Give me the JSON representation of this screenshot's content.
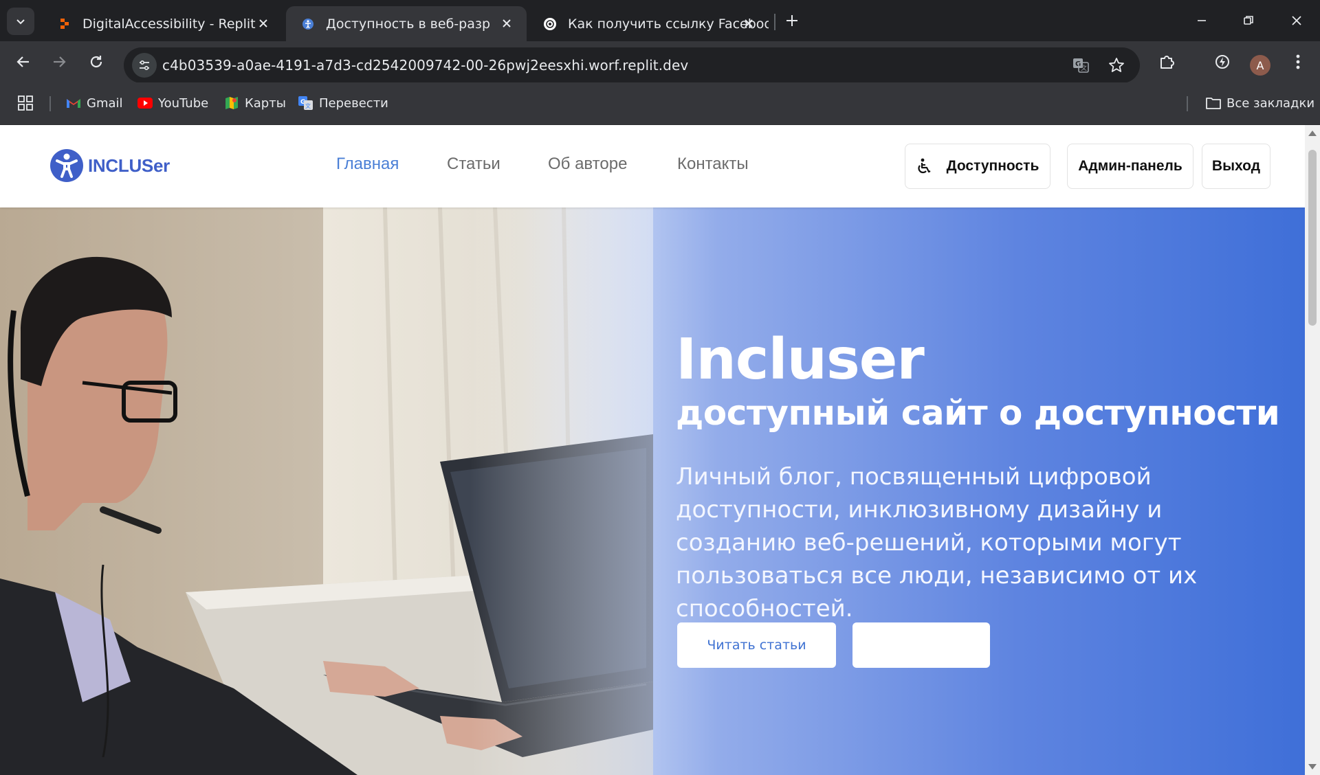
{
  "browser": {
    "tabs": [
      {
        "title": "DigitalAccessibility - Replit",
        "favicon": "replit-icon"
      },
      {
        "title": "Доступность в веб-разработке",
        "favicon": "site-icon",
        "active": true
      },
      {
        "title": "Как получить ссылку Facebook",
        "favicon": "openai-icon"
      }
    ],
    "url": "c4b03539-a0ae-4191-a7d3-cd2542009742-00-26pwj2eesxhi.worf.replit.dev",
    "profile_initial": "A",
    "bookmarks": [
      {
        "label": "Gmail",
        "icon": "gmail-icon"
      },
      {
        "label": "YouTube",
        "icon": "youtube-icon"
      },
      {
        "label": "Карты",
        "icon": "maps-icon"
      },
      {
        "label": "Перевести",
        "icon": "translate-icon"
      }
    ],
    "all_bookmarks": "Все закладки"
  },
  "site": {
    "logo_text": "INCLUSer",
    "nav": [
      "Главная",
      "Статьи",
      "Об авторе",
      "Контакты"
    ],
    "accessibility_button": "Доступность",
    "admin_button": "Админ-панель",
    "logout_button": "Выход"
  },
  "hero": {
    "title": "Incluser",
    "subtitle": "доступный сайт о доступности",
    "description": "Личный блог, посвященный цифровой доступности, инклюзивному дизайну и созданию веб-решений, которыми могут пользоваться все люди, независимо от их способностей.",
    "primary_button": "Читать статьи",
    "secondary_button": ""
  },
  "colors": {
    "accent": "#4a7fd6",
    "logo": "#3f5fc8",
    "hero_gradient_end": "#3f6fd8"
  }
}
